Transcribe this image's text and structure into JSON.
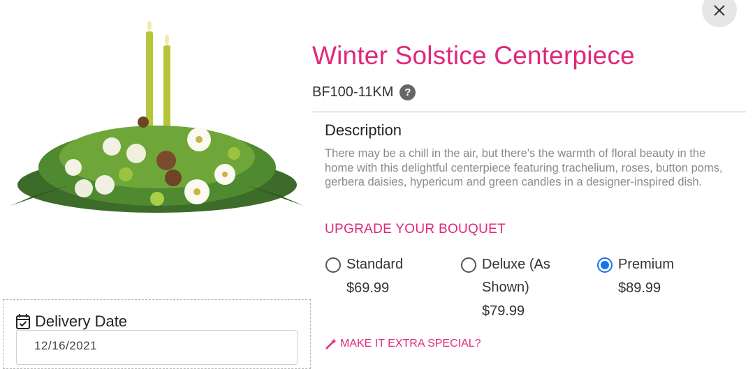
{
  "product": {
    "title": "Winter Solstice Centerpiece",
    "sku": "BF100-11KM",
    "help_icon_glyph": "?",
    "image_icon": "floral-centerpiece-image"
  },
  "close_glyph": "close-icon",
  "description": {
    "heading": "Description",
    "body": "There may be a chill in the air, but there's the warmth of floral beauty in the home with this delightful centerpiece featuring trachelium, roses, button poms, gerbera daisies, hypericum and green candles in a designer-inspired dish."
  },
  "upgrade": {
    "heading": "UPGRADE YOUR BOUQUET",
    "options": [
      {
        "label": "Standard",
        "price": "$69.99",
        "selected": false
      },
      {
        "label": "Deluxe (As Shown)",
        "price": "$79.99",
        "selected": false
      },
      {
        "label": "Premium",
        "price": "$89.99",
        "selected": true
      }
    ]
  },
  "extra": {
    "label": "MAKE IT EXTRA SPECIAL?",
    "icon": "magic-wand-icon"
  },
  "delivery": {
    "label": "Delivery Date",
    "value": "12/16/2021",
    "icon": "calendar-check-icon"
  },
  "colors": {
    "accent": "#e0287a",
    "radio_selected": "#1a73e8",
    "muted_text": "#8a8a8a"
  }
}
